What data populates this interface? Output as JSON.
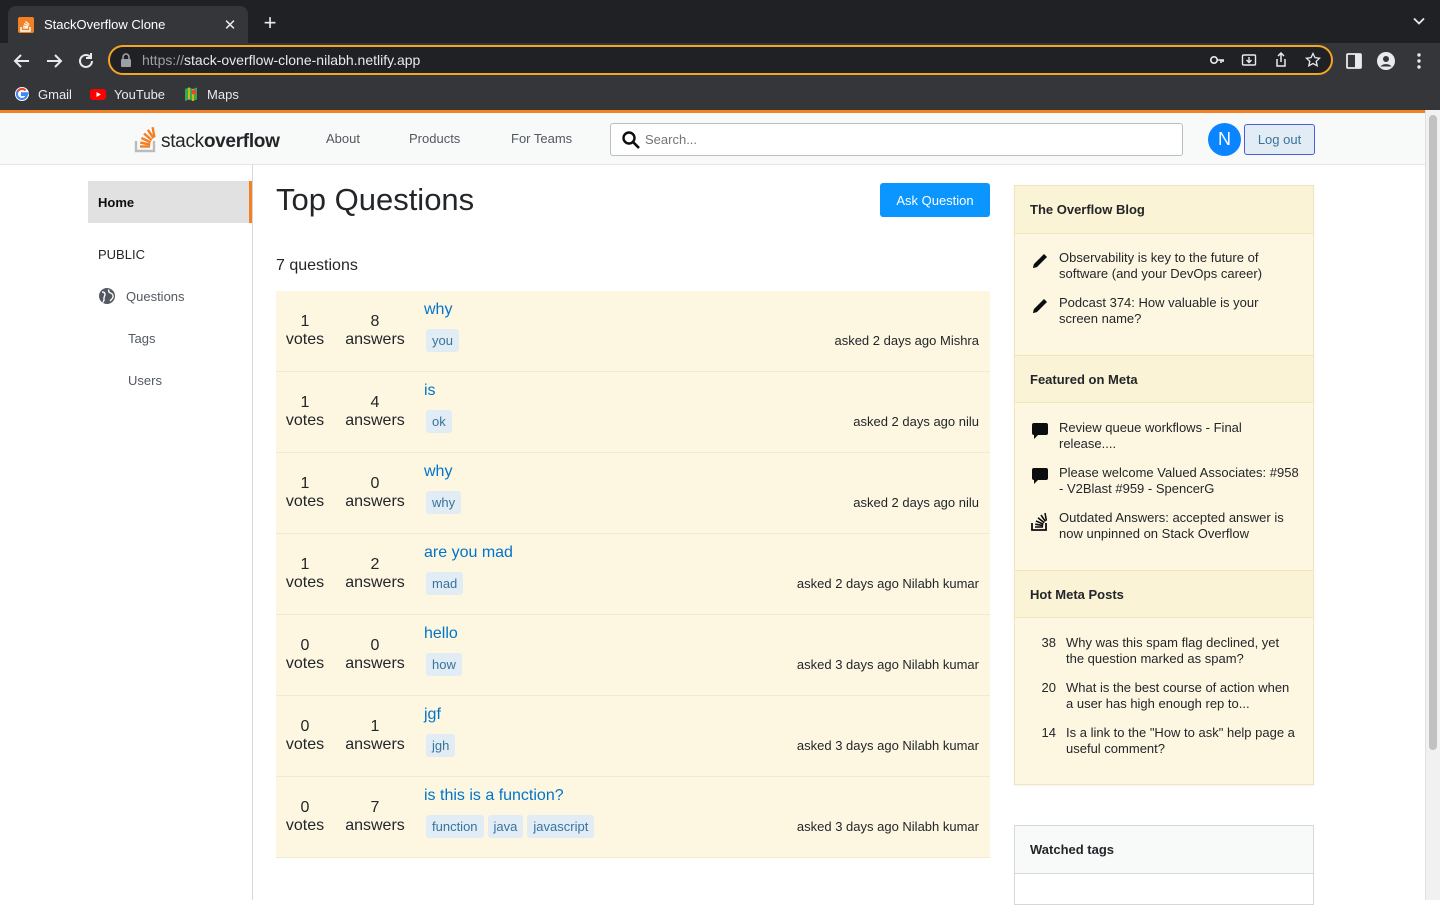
{
  "browser": {
    "tab_title": "StackOverflow Clone",
    "new_tab_symbol": "+",
    "close_symbol": "✕",
    "url_scheme": "https://",
    "url_host": "stack-overflow-clone-nilabh.netlify.app",
    "bookmarks": [
      {
        "label": "Gmail",
        "icon": "google-icon"
      },
      {
        "label": "YouTube",
        "icon": "youtube-icon"
      },
      {
        "label": "Maps",
        "icon": "maps-icon"
      }
    ]
  },
  "header": {
    "logo_light": "stack",
    "logo_bold": "overflow",
    "nav": [
      "About",
      "Products",
      "For Teams"
    ],
    "search_placeholder": "Search...",
    "avatar_letter": "N",
    "logout_label": "Log out"
  },
  "sidebar": {
    "home": "Home",
    "public": "PUBLIC",
    "questions": "Questions",
    "tags": "Tags",
    "users": "Users"
  },
  "main": {
    "title": "Top Questions",
    "ask_button": "Ask Question",
    "count": "7 questions",
    "questions": [
      {
        "votes": "1",
        "votes_label": "votes",
        "answers": "8",
        "answers_label": "answers",
        "title": "why",
        "tags": [
          "you"
        ],
        "asked": "asked 2 days ago Mishra"
      },
      {
        "votes": "1",
        "votes_label": "votes",
        "answers": "4",
        "answers_label": "answers",
        "title": "is",
        "tags": [
          "ok"
        ],
        "asked": "asked 2 days ago nilu"
      },
      {
        "votes": "1",
        "votes_label": "votes",
        "answers": "0",
        "answers_label": "answers",
        "title": "why",
        "tags": [
          "why"
        ],
        "asked": "asked 2 days ago nilu"
      },
      {
        "votes": "1",
        "votes_label": "votes",
        "answers": "2",
        "answers_label": "answers",
        "title": "are you mad",
        "tags": [
          "mad"
        ],
        "asked": "asked 2 days ago Nilabh kumar"
      },
      {
        "votes": "0",
        "votes_label": "votes",
        "answers": "0",
        "answers_label": "answers",
        "title": "hello",
        "tags": [
          "how"
        ],
        "asked": "asked 3 days ago Nilabh kumar"
      },
      {
        "votes": "0",
        "votes_label": "votes",
        "answers": "1",
        "answers_label": "answers",
        "title": "jgf",
        "tags": [
          "jgh"
        ],
        "asked": "asked 3 days ago Nilabh kumar"
      },
      {
        "votes": "0",
        "votes_label": "votes",
        "answers": "7",
        "answers_label": "answers",
        "title": "is this is a function?",
        "tags": [
          "function",
          "java",
          "javascript"
        ],
        "asked": "asked 3 days ago Nilabh kumar"
      }
    ]
  },
  "right": {
    "blog_title": "The Overflow Blog",
    "blog_items": [
      "Observability is key to the future of software (and your DevOps career)",
      "Podcast 374: How valuable is your screen name?"
    ],
    "meta_title": "Featured on Meta",
    "meta_items": [
      {
        "icon": "comment-icon",
        "text": "Review queue workflows - Final release...."
      },
      {
        "icon": "comment-icon",
        "text": "Please welcome Valued Associates: #958 - V2Blast #959 - SpencerG"
      },
      {
        "icon": "stackoverflow-icon",
        "text": "Outdated Answers: accepted answer is now unpinned on Stack Overflow"
      }
    ],
    "hot_title": "Hot Meta Posts",
    "hot_items": [
      {
        "num": "38",
        "text": "Why was this spam flag declined, yet the question marked as spam?"
      },
      {
        "num": "20",
        "text": "What is the best course of action when a user has high enough rep to..."
      },
      {
        "num": "14",
        "text": "Is a link to the \"How to ask\" help page a useful comment?"
      }
    ],
    "watched_title": "Watched tags"
  },
  "colors": {
    "accent_orange": "#f48024",
    "link_blue": "#0074cc",
    "primary_button": "#0a95ff",
    "question_bg": "#fdf7e2"
  }
}
